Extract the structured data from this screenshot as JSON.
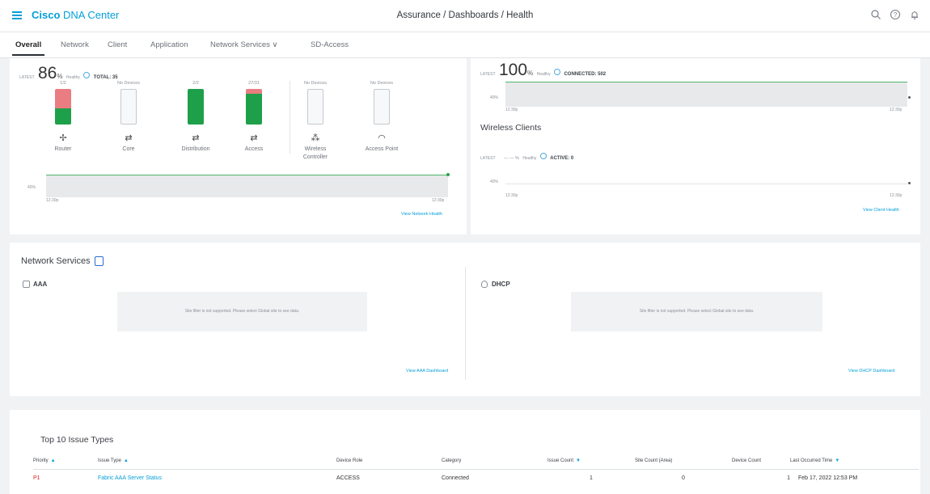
{
  "header": {
    "brand_bold": "Cisco",
    "brand_rest": " DNA Center",
    "breadcrumb": "Assurance / Dashboards / Health",
    "icons": [
      "search-icon",
      "help-icon",
      "notification-bell-icon"
    ]
  },
  "tabs": [
    "Overall",
    "Network",
    "Client",
    "Application",
    "Network Services ∨",
    "SD-Access"
  ],
  "network_health": {
    "latest_label": "LATEST",
    "percent": "86",
    "percent_sign": "%",
    "healthy_label": "Healthy",
    "total_label": "TOTAL: 35",
    "devices": [
      {
        "label": "Router",
        "count": "1/2",
        "green_fraction": 0.45,
        "red_fraction": 0.55,
        "icon": "router-icon"
      },
      {
        "label": "Core",
        "count": "No Devices",
        "green_fraction": 0,
        "red_fraction": 0,
        "icon": "core-switch-icon"
      },
      {
        "label": "Distribution",
        "count": "2/2",
        "green_fraction": 1,
        "red_fraction": 0,
        "icon": "distribution-switch-icon"
      },
      {
        "label": "Access",
        "count": "27/31",
        "green_fraction": 0.87,
        "red_fraction": 0.13,
        "icon": "access-switch-icon"
      },
      {
        "label": "Wireless\nController",
        "count": "No Devices",
        "green_fraction": 0,
        "red_fraction": 0,
        "icon": "wireless-controller-icon"
      },
      {
        "label": "Access Point",
        "count": "No Devices",
        "green_fraction": 0,
        "red_fraction": 0,
        "icon": "access-point-icon"
      }
    ],
    "chart_y_label": "40%",
    "chart_x_start": "12:30p",
    "chart_x_end": "12:30p",
    "view_link": "View Network Health"
  },
  "client_health": {
    "latest_label": "LATEST",
    "percent": "100",
    "percent_sign": "%",
    "healthy_label": "Healthy",
    "connected_label": "CONNECTED: 502",
    "chart_y_label": "40%",
    "chart_x_start": "12:30p",
    "chart_x_end": "12:30p",
    "wireless_title": "Wireless Clients",
    "wireless_latest_label": "LATEST",
    "wireless_percent": "— — %",
    "wireless_healthy_label": "Healthy",
    "wireless_active_label": "ACTIVE: 0",
    "wireless_chart_y_label": "40%",
    "wireless_chart_x_start": "12:30p",
    "wireless_chart_x_end": "12:30p",
    "view_link": "View Client Health"
  },
  "network_services": {
    "title": "Network Services",
    "aaa": {
      "title": "AAA",
      "message": "Site filter is not supported. Please select Global site to see data.",
      "view_link": "View AAA Dashboard"
    },
    "dhcp": {
      "title": "DHCP",
      "message": "Site filter is not supported. Please select Global site to see data.",
      "view_link": "View DHCP Dashboard"
    }
  },
  "issues": {
    "title": "Top 10 Issue Types",
    "columns": [
      "Priority",
      "Issue Type",
      "Device Role",
      "Category",
      "Issue Count",
      "Site Count (Area)",
      "Device Count",
      "Last Occurred Time"
    ],
    "sort_markers": [
      "▲",
      "▲",
      "",
      "",
      "▼",
      "",
      "",
      "▼"
    ],
    "rows": [
      {
        "priority": "P1",
        "issue_type": "Fabric AAA Server Status",
        "device_role": "ACCESS",
        "category": "Connected",
        "issue_count": "1",
        "site_count": "0",
        "device_count": "1",
        "last_occurred": "Feb 17, 2022 12:53 PM"
      }
    ],
    "priority_color": "#e2231a",
    "link_color": "#049fd9"
  }
}
